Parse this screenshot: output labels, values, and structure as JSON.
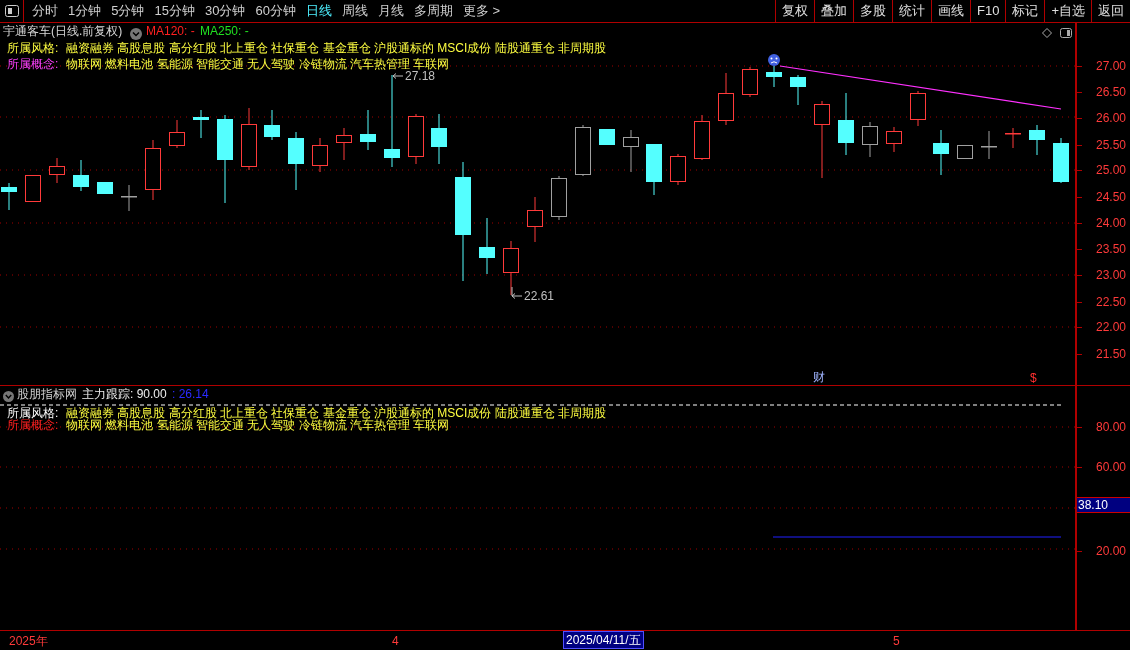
{
  "toolbar": {
    "periods": [
      {
        "label": "分时",
        "selected": false
      },
      {
        "label": "1分钟",
        "selected": false
      },
      {
        "label": "5分钟",
        "selected": false
      },
      {
        "label": "15分钟",
        "selected": false
      },
      {
        "label": "30分钟",
        "selected": false
      },
      {
        "label": "60分钟",
        "selected": false
      },
      {
        "label": "日线",
        "selected": true
      },
      {
        "label": "周线",
        "selected": false
      },
      {
        "label": "月线",
        "selected": false
      },
      {
        "label": "多周期",
        "selected": false
      },
      {
        "label": "更多 >",
        "selected": false
      }
    ],
    "buttons": [
      "复权",
      "叠加",
      "多股",
      "统计",
      "画线",
      "F10",
      "标记",
      "+自选",
      "返回"
    ]
  },
  "main_chart": {
    "title": "宇通客车(日线.前复权)",
    "indicators": [
      {
        "label": "MA120: -",
        "color": "#ff2020"
      },
      {
        "label": "MA250: -",
        "color": "#20e020"
      }
    ],
    "style_tags": {
      "label": "所属风格:",
      "text": "融资融券 高股息股 高分红股 北上重仓 社保重仓 基金重仓 沪股通标的 MSCI成份 陆股通重仓 非周期股"
    },
    "concept_tags": {
      "label": "所属概念:",
      "text": "物联网 燃料电池 氢能源 智能交通 无人驾驶 冷链物流 汽车热管理 车联网"
    },
    "high_label": "27.18",
    "low_label": "22.61",
    "markers": [
      {
        "text": "财",
        "kind": "finance"
      },
      {
        "text": "$",
        "kind": "dividend"
      }
    ],
    "axis_labels": [
      "27.00",
      "26.50",
      "26.00",
      "25.50",
      "25.00",
      "24.50",
      "24.00",
      "23.50",
      "23.00",
      "22.50",
      "22.00",
      "21.50"
    ]
  },
  "indicator_panel": {
    "title": "股朋指标网",
    "line_name": "主力跟踪: 90.00",
    "value": ": 26.14",
    "style_tags": {
      "label": "所属风格:",
      "text": "融资融券 高股息股 高分红股 北上重仓 社保重仓 基金重仓 沪股通标的 MSCI成份 陆股通重仓 非周期股"
    },
    "concept_tags": {
      "label": "所属概念:",
      "text": "物联网 燃料电池 氢能源 智能交通 无人驾驶 冷链物流 汽车热管理 车联网"
    },
    "axis_labels": [
      "80.00",
      "60.00",
      "20.00"
    ],
    "current_value": "38.10"
  },
  "time_axis": {
    "labels": [
      "2025年",
      "4",
      "5"
    ],
    "cursor_date": "2025/04/11/五"
  }
}
